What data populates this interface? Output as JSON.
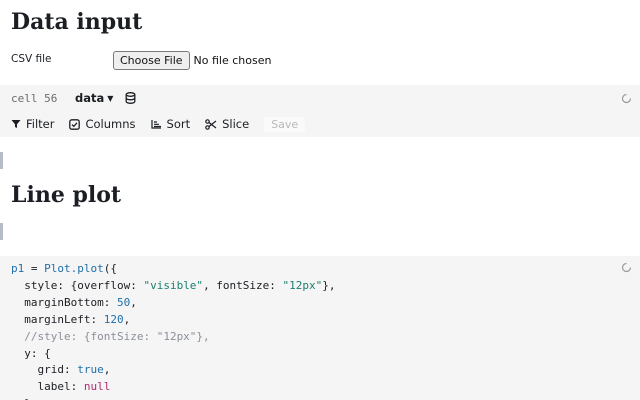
{
  "sections": {
    "data_input_title": "Data input",
    "line_plot_title": "Line plot"
  },
  "csv": {
    "label": "CSV file",
    "button_label": "Choose File",
    "status": "No file chosen"
  },
  "cell": {
    "id": "cell 56",
    "data_label": "data",
    "toolbar": {
      "filter": "Filter",
      "columns": "Columns",
      "sort": "Sort",
      "slice": "Slice",
      "save": "Save"
    }
  },
  "code": {
    "lines": [
      "p1 = Plot.plot({",
      "  style: {overflow: \"visible\", fontSize: \"12px\"},",
      "  marginBottom: 50,",
      "  marginLeft: 120,",
      "  //style: {fontSize: \"12px\"},",
      "  y: {",
      "    grid: true,",
      "    label: null",
      "  },"
    ]
  },
  "colors": {
    "cell_background": "#f5f5f5",
    "gutter_marker": "#b7bcc6",
    "string": "#1a7f6e",
    "keyword": "#1f6fa8",
    "null": "#b3286f",
    "comment": "#8a8f98"
  }
}
